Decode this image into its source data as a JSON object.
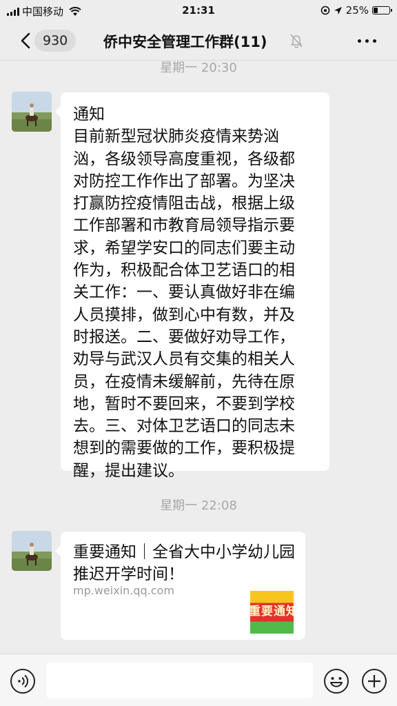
{
  "status_bar": {
    "carrier": "中国移动",
    "time": "21:31",
    "battery": "25%",
    "battery_level": 0.25
  },
  "nav": {
    "back_icon": "chevron-left-icon",
    "unread_count": "930",
    "title": "侨中安全管理工作群(11)",
    "mute_icon": "bell-off-icon",
    "more_icon": "more-dots-icon"
  },
  "messages": [
    {
      "time": "星期一 20:30",
      "type": "text",
      "text": "通知\n目前新型冠状肺炎疫情来势汹\n汹，各级领导高度重视，各级都\n对防控工作作出了部署。为坚决\n打赢防控疫情阻击战，根据上级\n工作部署和市教育局领导指示要\n求，希望学安口的同志们要主动\n作为，积极配合体卫艺语口的相\n关工作：一、要认真做好非在编\n人员摸排，做到心中有数，并及\n时报送。二、要做好劝导工作，\n劝导与武汉人员有交集的相关人\n员，在疫情未缓解前，先待在原\n地，暂时不要回来，不要到学校\n去。三、对体卫艺语口的同志未\n想到的需要做的工作，要积极提\n醒，提出建议。"
    },
    {
      "time": "星期一 22:08",
      "type": "link",
      "title": "重要通知｜全省大中小学幼儿园推迟开学时间！",
      "source": "mp.weixin.qq.com",
      "thumb_text": "重要通知"
    }
  ],
  "input_bar": {
    "voice_icon": "voice-icon",
    "emoji_icon": "emoji-icon",
    "plus_icon": "plus-icon"
  }
}
